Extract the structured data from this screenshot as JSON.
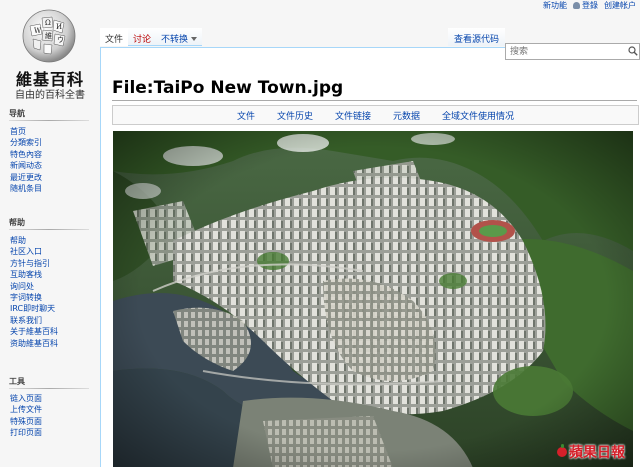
{
  "site": {
    "logo_title": "維基百科",
    "logo_subtitle": "自由的百科全書"
  },
  "personal": {
    "links": [
      "新功能",
      "登錄",
      "创建帐户"
    ]
  },
  "tabs": {
    "left": [
      {
        "label": "文件",
        "selected": true
      },
      {
        "label": "讨论",
        "red": true
      },
      {
        "label": "不转换",
        "dropdown": true
      }
    ],
    "view_source": "查看源代码"
  },
  "search": {
    "placeholder": "搜索"
  },
  "sidebar": {
    "nav_heading": "导航",
    "nav_items": [
      "首页",
      "分類索引",
      "特色內容",
      "新闻动态",
      "最近更改",
      "随机条目"
    ],
    "help_heading": "帮助",
    "help_items": [
      "帮助",
      "社区入口",
      "方针与指引",
      "互助客栈",
      "询问处",
      "字词转换",
      "IRC即时聊天",
      "联系我们",
      "关于維基百科",
      "资助維基百科"
    ],
    "tools_heading": "工具",
    "tools_items": [
      "链入页面",
      "上传文件",
      "特殊页面",
      "打印页面"
    ]
  },
  "page": {
    "title": "File:TaiPo New Town.jpg",
    "filetoc": [
      "文件",
      "文件历史",
      "文件链接",
      "元数据",
      "全域文件使用情况"
    ]
  },
  "photo": {
    "watermark": "蘋果日報",
    "colors": {
      "hills": "#3f6b2e",
      "water": "#3c4a55",
      "city": "#cfcfc9",
      "shadow": "#5d6a58"
    }
  },
  "icons": {
    "logo": "wikipedia-globe-icon",
    "search_button": "magnifier-icon",
    "user": "user-icon"
  }
}
